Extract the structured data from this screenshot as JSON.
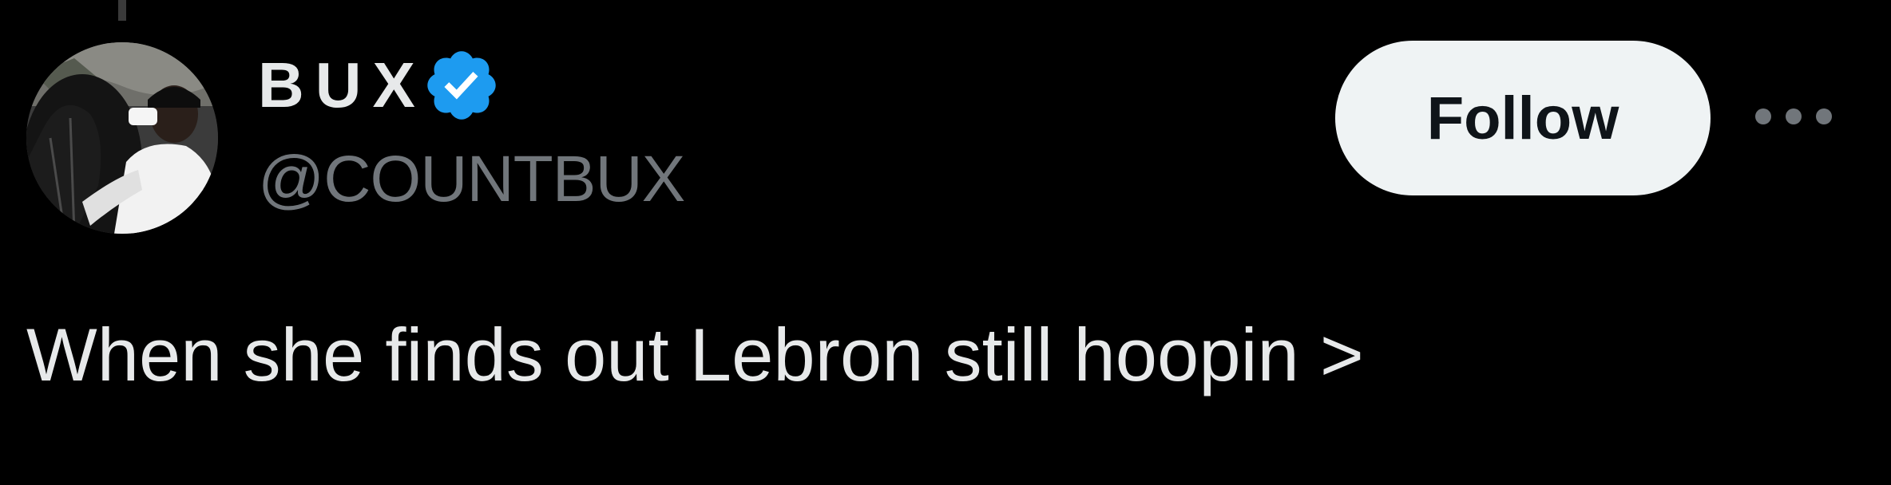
{
  "author": {
    "display_name": "BUX",
    "handle": "@COUNTBUX",
    "verified": true,
    "verified_icon": "verified-badge-icon",
    "avatar_icon": "profile-photo"
  },
  "actions": {
    "follow_label": "Follow",
    "more_icon": "more-options-icon"
  },
  "tweet": {
    "text": "When she finds out Lebron still hoopin >"
  },
  "colors": {
    "background": "#000000",
    "primary_text": "#e7e9ea",
    "secondary_text": "#71767b",
    "follow_bg": "#eff3f4",
    "follow_text": "#0f1419",
    "verified_blue": "#1d9bf0"
  }
}
